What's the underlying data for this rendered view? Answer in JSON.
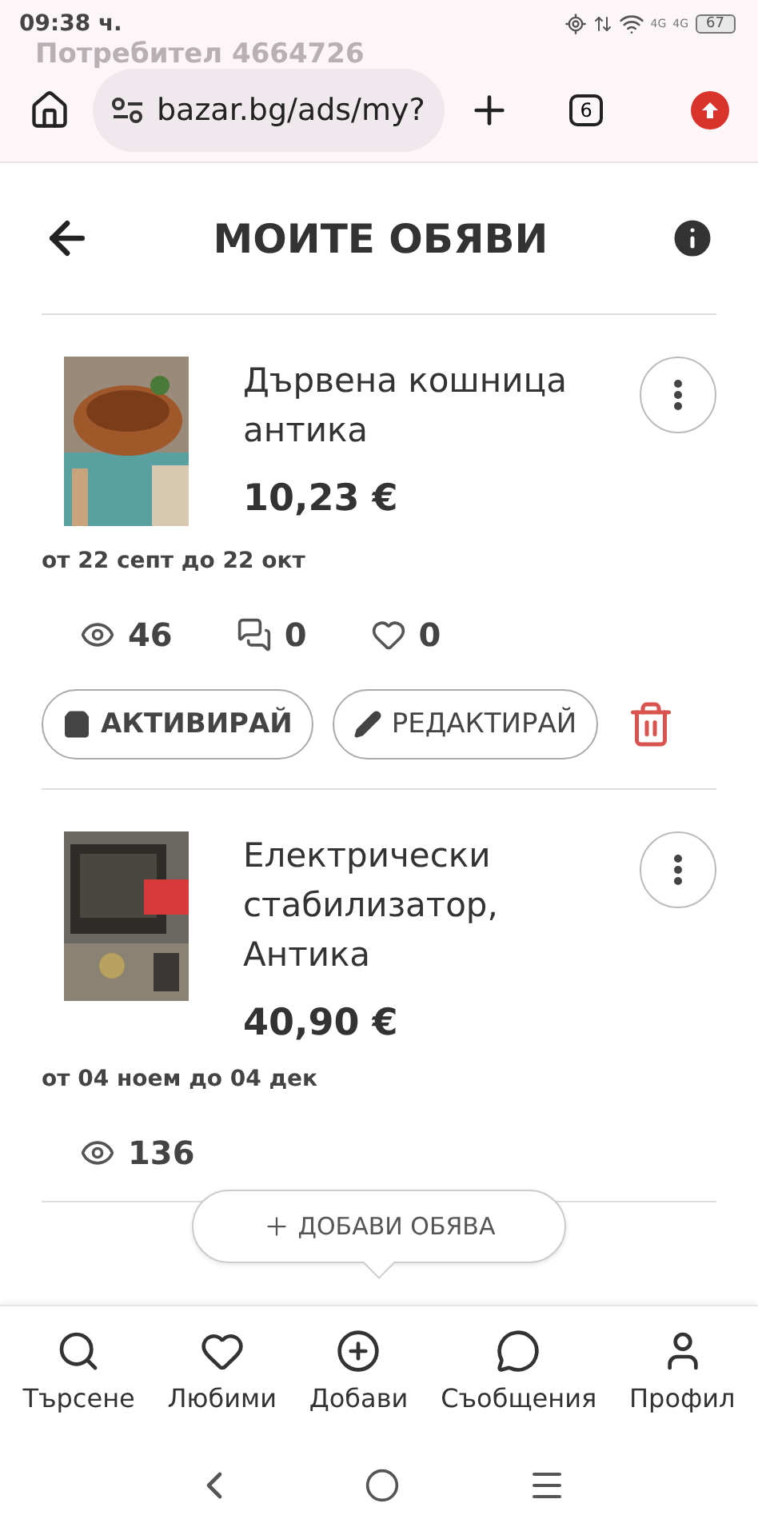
{
  "status_bar": {
    "time": "09:38 ч.",
    "network_labels": [
      "4G",
      "4G"
    ],
    "battery": "67"
  },
  "faded_title": "Потребител 4664726",
  "browser": {
    "url": "bazar.bg/ads/my?",
    "tab_count": "6"
  },
  "header": {
    "title": "МОИТЕ ОБЯВИ"
  },
  "ads": [
    {
      "title": "Дървена кошница антика",
      "price": "10,23 €",
      "dates": "от 22 септ до 22 окт",
      "stats": [
        {
          "kind": "views",
          "value": "46"
        },
        {
          "kind": "messages",
          "value": "0"
        },
        {
          "kind": "likes",
          "value": "0"
        }
      ],
      "actions": [
        {
          "kind": "activate",
          "label": "АКТИВИРАЙ"
        },
        {
          "kind": "edit",
          "label": "РЕДАКТИРАЙ"
        },
        {
          "kind": "delete"
        }
      ]
    },
    {
      "title": "Електрически стабилизатор, Антика",
      "price": "40,90 €",
      "dates": "от 04 ноем до 04 дек",
      "stats": [
        {
          "kind": "views",
          "value": "136"
        }
      ]
    }
  ],
  "add_tooltip": {
    "label": "ДОБАВИ ОБЯВА"
  },
  "bottom_nav": [
    {
      "kind": "search",
      "label": "Търсене"
    },
    {
      "kind": "favorites",
      "label": "Любими"
    },
    {
      "kind": "add",
      "label": "Добави"
    },
    {
      "kind": "messages",
      "label": "Съобщения"
    },
    {
      "kind": "profile",
      "label": "Профил"
    }
  ]
}
